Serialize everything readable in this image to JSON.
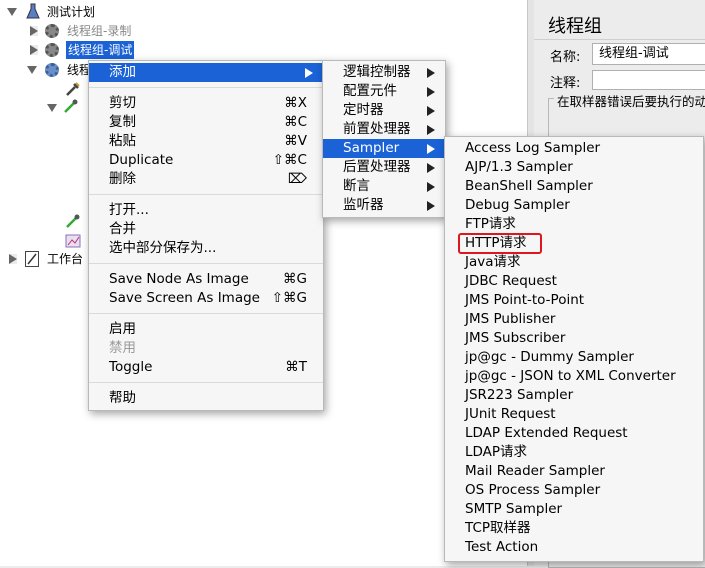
{
  "tree": {
    "root": "测试计划",
    "group_record": "线程组-录制",
    "group_debug": "线程组-调试",
    "group_third": "线程",
    "workbench": "工作台"
  },
  "panel": {
    "title": "线程组",
    "name_label": "名称:",
    "name_value": "线程组-调试",
    "comment_label": "注释:",
    "on_error": "在取样器错误后要执行的动"
  },
  "context_menu": {
    "add": "添加",
    "cut": "剪切",
    "cut_sc": "⌘X",
    "copy": "复制",
    "copy_sc": "⌘C",
    "paste": "粘贴",
    "paste_sc": "⌘V",
    "duplicate": "Duplicate",
    "duplicate_sc": "⇧⌘C",
    "delete": "删除",
    "delete_sc": "⌦",
    "open": "打开...",
    "merge": "合并",
    "save_selection": "选中部分保存为...",
    "save_node_image": "Save Node As Image",
    "save_node_image_sc": "⌘G",
    "save_screen_image": "Save Screen As Image",
    "save_screen_image_sc": "⇧⌘G",
    "enable": "启用",
    "disable": "禁用",
    "toggle": "Toggle",
    "toggle_sc": "⌘T",
    "help": "帮助"
  },
  "add_menu": {
    "logic_controller": "逻辑控制器",
    "config_element": "配置元件",
    "timer": "定时器",
    "pre_processor": "前置处理器",
    "sampler": "Sampler",
    "post_processor": "后置处理器",
    "assertion": "断言",
    "listener": "监听器"
  },
  "sampler_menu": {
    "items": [
      "Access Log Sampler",
      "AJP/1.3 Sampler",
      "BeanShell Sampler",
      "Debug Sampler",
      "FTP请求",
      "HTTP请求",
      "Java请求",
      "JDBC Request",
      "JMS Point-to-Point",
      "JMS Publisher",
      "JMS Subscriber",
      "jp@gc - Dummy Sampler",
      "jp@gc - JSON to XML Converter",
      "JSR223 Sampler",
      "JUnit Request",
      "LDAP Extended Request",
      "LDAP请求",
      "Mail Reader Sampler",
      "OS Process Sampler",
      "SMTP Sampler",
      "TCP取样器",
      "Test Action"
    ],
    "highlight_color": "#e0161e"
  }
}
